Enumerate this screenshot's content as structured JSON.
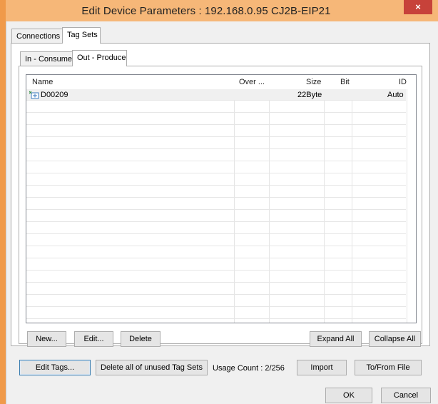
{
  "window": {
    "title": "Edit Device Parameters : 192.168.0.95 CJ2B-EIP21",
    "close_glyph": "×"
  },
  "tabs_outer": [
    {
      "label": "Connections"
    },
    {
      "label": "Tag Sets"
    }
  ],
  "tabs_inner": [
    {
      "label": "In - Consume"
    },
    {
      "label": "Out - Produce"
    }
  ],
  "list": {
    "columns": {
      "name": "Name",
      "over": "Over ...",
      "size": "Size",
      "bit": "Bit",
      "id": "ID"
    },
    "rows": [
      {
        "name": "D00209",
        "over": "",
        "size": "22Byte",
        "bit": "",
        "id": "Auto",
        "icon": "tag-set-icon"
      }
    ]
  },
  "buttons": {
    "new": "New...",
    "edit": "Edit...",
    "delete": "Delete",
    "expand_all": "Expand All",
    "collapse_all": "Collapse All",
    "edit_tags": "Edit Tags...",
    "delete_unused": "Delete all of unused Tag Sets",
    "import": "Import",
    "to_from_file": "To/From File",
    "ok": "OK",
    "cancel": "Cancel"
  },
  "usage": {
    "label": "Usage Count :",
    "value": "2/256"
  },
  "colors": {
    "titlebar": "#f6b778",
    "accent": "#f09a4a",
    "close": "#c7423a",
    "focus_border": "#3c7fb1"
  }
}
